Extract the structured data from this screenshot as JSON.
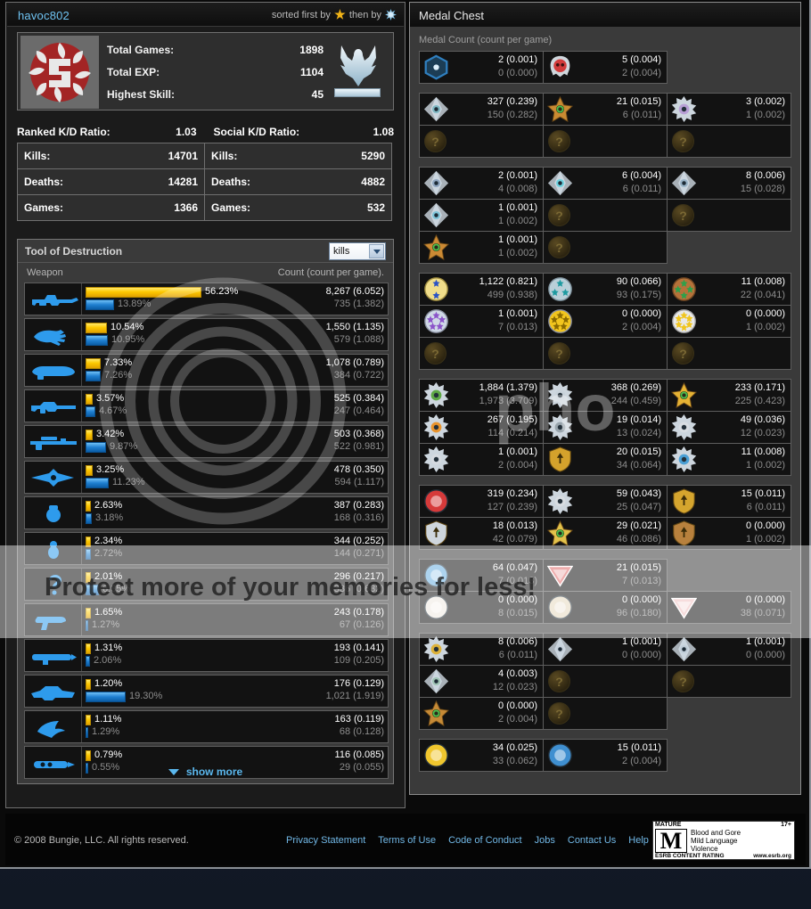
{
  "header": {
    "username": "havoc802",
    "sorted_prefix": "sorted first by",
    "sorted_mid": "then by",
    "icon_first": "gold-star-icon",
    "icon_second": "blue-snowflake-icon"
  },
  "hero": {
    "emblem_name": "player-emblem",
    "rank_name": "eagle-rank-insignia",
    "stats": [
      {
        "label": "Total Games:",
        "value": "1898"
      },
      {
        "label": "Total EXP:",
        "value": "1104"
      },
      {
        "label": "Highest Skill:",
        "value": "45"
      }
    ]
  },
  "kd": {
    "ranked_label": "Ranked K/D Ratio:",
    "ranked_value": "1.03",
    "social_label": "Social K/D Ratio:",
    "social_value": "1.08",
    "rows": [
      {
        "label": "Kills:",
        "ranked": "14701",
        "social": "5290"
      },
      {
        "label": "Deaths:",
        "ranked": "14281",
        "social": "4882"
      },
      {
        "label": "Games:",
        "ranked": "1366",
        "social": "532"
      }
    ]
  },
  "tool_of_destruction": {
    "title": "Tool of Destruction",
    "select_value": "kills",
    "select_options": [
      "kills"
    ],
    "col_weapon": "Weapon",
    "col_count": "Count (count per game).",
    "show_more": "show more",
    "max_scale_pct": 56.23,
    "weapons": [
      {
        "icon": "battle-rifle-icon",
        "pct_top": "56.23%",
        "pct_bot": "13.89%",
        "top_pct_num": 56.23,
        "bot_pct_num": 13.89,
        "count_top": "8,267 (6.052)",
        "count_bot": "735 (1.382)"
      },
      {
        "icon": "assault-melee-icon",
        "pct_top": "10.54%",
        "pct_bot": "10.95%",
        "top_pct_num": 10.54,
        "bot_pct_num": 10.95,
        "count_top": "1,550 (1.135)",
        "count_bot": "579 (1.088)"
      },
      {
        "icon": "brute-shot-icon",
        "pct_top": "7.33%",
        "pct_bot": "7.26%",
        "top_pct_num": 7.33,
        "bot_pct_num": 7.26,
        "count_top": "1,078 (0.789)",
        "count_bot": "384 (0.722)"
      },
      {
        "icon": "shotgun-icon",
        "pct_top": "3.57%",
        "pct_bot": "4.67%",
        "top_pct_num": 3.57,
        "bot_pct_num": 4.67,
        "count_top": "525 (0.384)",
        "count_bot": "247 (0.464)"
      },
      {
        "icon": "sniper-rifle-icon",
        "pct_top": "3.42%",
        "pct_bot": "9.87%",
        "top_pct_num": 3.42,
        "bot_pct_num": 9.87,
        "count_top": "503 (0.368)",
        "count_bot": "522 (0.981)"
      },
      {
        "icon": "energy-sword-icon",
        "pct_top": "3.25%",
        "pct_bot": "11.23%",
        "top_pct_num": 3.25,
        "bot_pct_num": 11.23,
        "count_top": "478 (0.350)",
        "count_bot": "594 (1.117)"
      },
      {
        "icon": "frag-grenade-icon",
        "pct_top": "2.63%",
        "pct_bot": "3.18%",
        "top_pct_num": 2.63,
        "bot_pct_num": 3.18,
        "count_top": "387 (0.283)",
        "count_bot": "168 (0.316)"
      },
      {
        "icon": "plasma-grenade-icon",
        "pct_top": "2.34%",
        "pct_bot": "2.72%",
        "top_pct_num": 2.34,
        "bot_pct_num": 2.72,
        "count_top": "344 (0.252)",
        "count_bot": "144 (0.271)"
      },
      {
        "icon": "unknown-weapon-icon",
        "pct_top": "2.01%",
        "pct_bot": "6.35%",
        "top_pct_num": 2.01,
        "bot_pct_num": 6.35,
        "count_top": "296 (0.217)",
        "count_bot": "336 (0.632)"
      },
      {
        "icon": "plasma-pistol-icon",
        "pct_top": "1.65%",
        "pct_bot": "1.27%",
        "top_pct_num": 1.65,
        "bot_pct_num": 1.27,
        "count_top": "243 (0.178)",
        "count_bot": "67 (0.126)"
      },
      {
        "icon": "rocket-launcher-icon",
        "pct_top": "1.31%",
        "pct_bot": "2.06%",
        "top_pct_num": 1.31,
        "bot_pct_num": 2.06,
        "count_top": "193 (0.141)",
        "count_bot": "109 (0.205)"
      },
      {
        "icon": "warthog-icon",
        "pct_top": "1.20%",
        "pct_bot": "19.30%",
        "top_pct_num": 1.2,
        "bot_pct_num": 19.3,
        "count_top": "176 (0.129)",
        "count_bot": "1,021 (1.919)"
      },
      {
        "icon": "needler-icon",
        "pct_top": "1.11%",
        "pct_bot": "1.29%",
        "top_pct_num": 1.11,
        "bot_pct_num": 1.29,
        "count_top": "163 (0.119)",
        "count_bot": "68 (0.128)"
      },
      {
        "icon": "spartan-laser-icon",
        "pct_top": "0.79%",
        "pct_bot": "0.55%",
        "top_pct_num": 0.79,
        "bot_pct_num": 0.55,
        "count_top": "116 (0.085)",
        "count_bot": "29 (0.055)"
      }
    ]
  },
  "medal_chest": {
    "title": "Medal Chest",
    "subtitle": "Medal Count (count per game)",
    "locked_glyph": "?",
    "groups": [
      {
        "cells": [
          {
            "icon": "hexagon-blue-medal",
            "color": "#2f7fbf",
            "shape": "hex",
            "v1": "2 (0.001)",
            "v2": "0 (0.000)"
          },
          {
            "icon": "red-skull-medal",
            "color": "#d23b3b",
            "shape": "skull",
            "v1": "5 (0.004)",
            "v2": "2 (0.004)"
          }
        ]
      },
      {
        "cells": [
          {
            "icon": "silver-diamond-teal-medal",
            "color": "#7fb8c4",
            "shape": "diamond",
            "v1": "327 (0.239)",
            "v2": "150 (0.282)"
          },
          {
            "icon": "bronze-star-green-medal",
            "color": "#c98a32",
            "shape": "star",
            "v1": "21 (0.015)",
            "v2": "6 (0.011)"
          },
          {
            "icon": "silver-burst-purple-medal",
            "color": "#b9a0d6",
            "shape": "burst",
            "v1": "3 (0.002)",
            "v2": "1 (0.002)"
          },
          {
            "icon": "locked-medal",
            "locked": true
          },
          {
            "icon": "locked-medal",
            "locked": true
          },
          {
            "icon": "locked-medal",
            "locked": true
          }
        ]
      },
      {
        "cells": [
          {
            "icon": "silver-diamond-blue-medal",
            "color": "#8fa6c0",
            "shape": "diamond",
            "v1": "2 (0.001)",
            "v2": "4 (0.008)"
          },
          {
            "icon": "silver-diamond-flame-medal",
            "color": "#6fd3e0",
            "shape": "diamond",
            "v1": "6 (0.004)",
            "v2": "6 (0.011)"
          },
          {
            "icon": "silver-diamond-cross-medal",
            "color": "#9ab4c8",
            "shape": "diamond",
            "v1": "8 (0.006)",
            "v2": "15 (0.028)"
          },
          {
            "icon": "silver-diamond-globe-medal",
            "color": "#7fc4d8",
            "shape": "diamond",
            "v1": "1 (0.001)",
            "v2": "1 (0.002)"
          },
          {
            "icon": "locked-medal",
            "locked": true
          },
          {
            "icon": "locked-medal",
            "locked": true
          },
          {
            "icon": "bronze-star-target-medal",
            "color": "#cb8a34",
            "shape": "star",
            "v1": "1 (0.001)",
            "v2": "1 (0.002)"
          },
          {
            "icon": "locked-medal",
            "locked": true
          },
          {
            "icon": "empty-cell",
            "empty": true
          }
        ]
      },
      {
        "cells": [
          {
            "icon": "gold-double-star-medal",
            "color": "#f0dd8a",
            "shape": "circle2",
            "v1": "1,122 (0.821)",
            "v2": "499 (0.938)"
          },
          {
            "icon": "silver-triple-star-medal",
            "color": "#b9cfd8",
            "shape": "circle3",
            "v1": "90 (0.066)",
            "v2": "93 (0.175)"
          },
          {
            "icon": "bronze-quad-star-medal",
            "color": "#b5723a",
            "shape": "circle4",
            "v1": "11 (0.008)",
            "v2": "22 (0.041)"
          },
          {
            "icon": "silver-penta-star-medal",
            "color": "#cfd9e6",
            "shape": "circle5",
            "v1": "1 (0.001)",
            "v2": "7 (0.013)"
          },
          {
            "icon": "gold-multi-star-medal",
            "color": "#f2c51e",
            "shape": "circle5",
            "v1": "0 (0.000)",
            "v2": "2 (0.004)"
          },
          {
            "icon": "white-multi-star-medal",
            "color": "#e9e9e9",
            "shape": "circle6",
            "v1": "0 (0.000)",
            "v2": "1 (0.002)"
          },
          {
            "icon": "locked-medal",
            "locked": true
          },
          {
            "icon": "locked-medal",
            "locked": true
          },
          {
            "icon": "locked-medal",
            "locked": true
          }
        ]
      },
      {
        "cells": [
          {
            "icon": "green-fist-medal",
            "color": "#5ea845",
            "shape": "burst",
            "v1": "1,884 (1.379)",
            "v2": "1,973 (3.709)"
          },
          {
            "icon": "silver-assassin-medal",
            "color": "#c8d2da",
            "shape": "burst",
            "v1": "368 (0.269)",
            "v2": "244 (0.459)"
          },
          {
            "icon": "gold-sniper-star-medal",
            "color": "#e5b234",
            "shape": "star",
            "v1": "233 (0.171)",
            "v2": "225 (0.423)"
          },
          {
            "icon": "orange-plasma-medal",
            "color": "#e8932c",
            "shape": "burst",
            "v1": "267 (0.195)",
            "v2": "114 (0.214)"
          },
          {
            "icon": "grey-sphere-medal",
            "color": "#98a4ac",
            "shape": "burst",
            "v1": "19 (0.014)",
            "v2": "13 (0.024)"
          },
          {
            "icon": "silver-red-gem-medal",
            "color": "#d8dde2",
            "shape": "burst",
            "v1": "49 (0.036)",
            "v2": "12 (0.023)"
          },
          {
            "icon": "silver-flag-medal",
            "color": "#d5dae0",
            "shape": "burst",
            "v1": "1 (0.001)",
            "v2": "2 (0.004)"
          },
          {
            "icon": "gold-shield-medal",
            "color": "#d4a22c",
            "shape": "shield",
            "v1": "20 (0.015)",
            "v2": "34 (0.064)"
          },
          {
            "icon": "blue-red-burst-medal",
            "color": "#4aa0d6",
            "shape": "burst",
            "v1": "11 (0.008)",
            "v2": "1 (0.002)"
          }
        ]
      },
      {
        "cells": [
          {
            "icon": "no-smiley-medal",
            "color": "#d63a3a",
            "shape": "circle",
            "v1": "319 (0.234)",
            "v2": "127 (0.239)"
          },
          {
            "icon": "silver-spike-medal",
            "color": "#d8dde2",
            "shape": "burst",
            "v1": "59 (0.043)",
            "v2": "25 (0.047)"
          },
          {
            "icon": "gold-arrow-medal",
            "color": "#d5a52e",
            "shape": "shield",
            "v1": "15 (0.011)",
            "v2": "6 (0.011)"
          },
          {
            "icon": "silver-bull-medal",
            "color": "#cfd6dd",
            "shape": "shield",
            "v1": "18 (0.013)",
            "v2": "42 (0.079)"
          },
          {
            "icon": "gold-star-small-medal",
            "color": "#e3c24a",
            "shape": "star",
            "v1": "29 (0.021)",
            "v2": "46 (0.086)"
          },
          {
            "icon": "bronze-eagle-medal",
            "color": "#b8813d",
            "shape": "shield",
            "v1": "0 (0.000)",
            "v2": "1 (0.002)"
          }
        ]
      },
      {
        "cells": [
          {
            "icon": "flag-capture-medal",
            "color": "#6ab0e0",
            "shape": "circle",
            "v1": "64 (0.047)",
            "v2": "7 (0.013)"
          },
          {
            "icon": "red-flag-return-medal",
            "color": "#e06a6a",
            "shape": "triangle",
            "v1": "21 (0.015)",
            "v2": "7 (0.013)"
          },
          {
            "icon": "empty-cell",
            "empty": true
          },
          {
            "icon": "white-star-circle-medal",
            "color": "#efe9e2",
            "shape": "circle",
            "v1": "0 (0.000)",
            "v2": "8 (0.015)"
          },
          {
            "icon": "bomb-plant-medal",
            "color": "#e6d9c0",
            "shape": "circle",
            "v1": "0 (0.000)",
            "v2": "96 (0.180)"
          },
          {
            "icon": "pink-shield-medal",
            "color": "#f0c2c2",
            "shape": "triangle",
            "v1": "0 (0.000)",
            "v2": "38 (0.071)"
          }
        ]
      },
      {
        "cells": [
          {
            "icon": "gold-compass-medal",
            "color": "#ddb23a",
            "shape": "burst",
            "v1": "8 (0.006)",
            "v2": "6 (0.011)"
          },
          {
            "icon": "silver-diamond-hand-medal",
            "color": "#c8d2dc",
            "shape": "diamond",
            "v1": "1 (0.001)",
            "v2": "0 (0.000)"
          },
          {
            "icon": "silver-diamond-head-medal",
            "color": "#c0cdd8",
            "shape": "diamond",
            "v1": "1 (0.001)",
            "v2": "0 (0.000)"
          },
          {
            "icon": "silver-diamond-leaf-medal",
            "color": "#9fc4b4",
            "shape": "diamond",
            "v1": "4 (0.003)",
            "v2": "12 (0.023)"
          },
          {
            "icon": "locked-medal",
            "locked": true
          },
          {
            "icon": "locked-medal",
            "locked": true
          },
          {
            "icon": "bronze-star-circle-medal",
            "color": "#c68a36",
            "shape": "star",
            "v1": "0 (0.000)",
            "v2": "2 (0.004)"
          },
          {
            "icon": "locked-medal",
            "locked": true
          },
          {
            "icon": "empty-cell",
            "empty": true
          }
        ]
      },
      {
        "cells": [
          {
            "icon": "gold-coin-medal",
            "color": "#f0c62e",
            "shape": "circle",
            "v1": "34 (0.025)",
            "v2": "33 (0.062)"
          },
          {
            "icon": "blue-medic-medal",
            "color": "#3f8fd0",
            "shape": "circle",
            "v1": "15 (0.011)",
            "v2": "2 (0.004)"
          }
        ]
      }
    ]
  },
  "footer": {
    "copyright": "© 2008 Bungie, LLC. All rights reserved.",
    "links": [
      "Privacy Statement",
      "Terms of Use",
      "Code of Conduct",
      "Jobs",
      "Contact Us",
      "Help"
    ],
    "esrb": {
      "rating_word": "MATURE",
      "age": "17+",
      "letter": "M",
      "descriptors": [
        "Blood and Gore",
        "Mild Language",
        "Violence"
      ],
      "footer_left": "ESRB CONTENT RATING",
      "footer_right": "www.esrb.org"
    }
  },
  "watermark": {
    "text": "Protect more of your memories for less!",
    "brand": "pho"
  }
}
